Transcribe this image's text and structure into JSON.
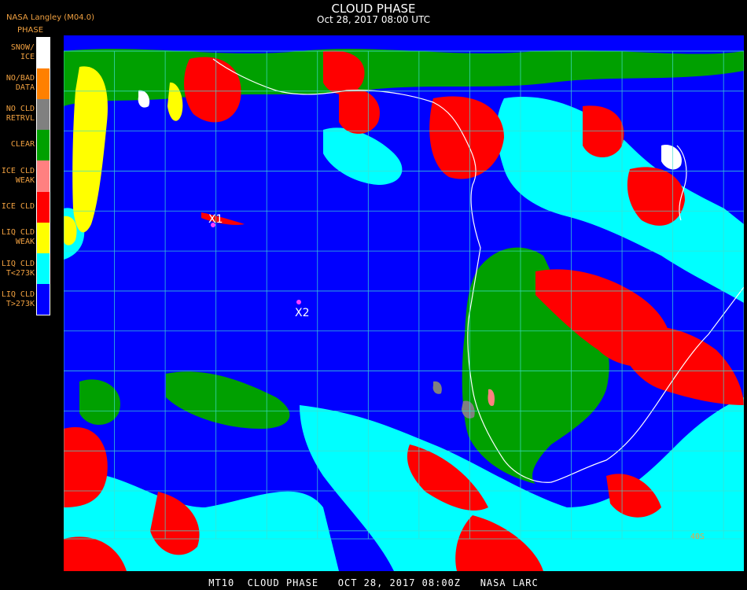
{
  "header": {
    "title": "CLOUD PHASE",
    "timestamp": "Oct 28, 2017 08:00 UTC",
    "producer": "NASA Langley (M04.0)",
    "legend_title": "PHASE"
  },
  "legend": [
    {
      "line1": "SNOW/",
      "line2": "ICE",
      "color": "#ffffff"
    },
    {
      "line1": "NO/BAD",
      "line2": "DATA",
      "color": "#ff8000"
    },
    {
      "line1": "NO CLD",
      "line2": "RETRVL",
      "color": "#808080"
    },
    {
      "line1": "CLEAR",
      "line2": "",
      "color": "#00a000"
    },
    {
      "line1": "ICE CLD",
      "line2": "WEAK",
      "color": "#ff8080"
    },
    {
      "line1": "ICE CLD",
      "line2": "",
      "color": "#ff0000"
    },
    {
      "line1": "LIQ CLD",
      "line2": "WEAK",
      "color": "#ffff00"
    },
    {
      "line1": "LIQ CLD",
      "line2": "T<273K",
      "color": "#00ffff"
    },
    {
      "line1": "LIQ CLD",
      "line2": "T>273K",
      "color": "#0000ff"
    }
  ],
  "map": {
    "markers": [
      {
        "label": "X1",
        "color": "#ff40ff"
      },
      {
        "label": "X2",
        "color": "#ff40ff"
      }
    ],
    "lat_label_bottom": "40S",
    "grid_color": "#40e0d0",
    "coast_color": "#ffffff"
  },
  "footer": {
    "text": "MT10  CLOUD PHASE   OCT 28, 2017 08:00Z   NASA LARC"
  }
}
